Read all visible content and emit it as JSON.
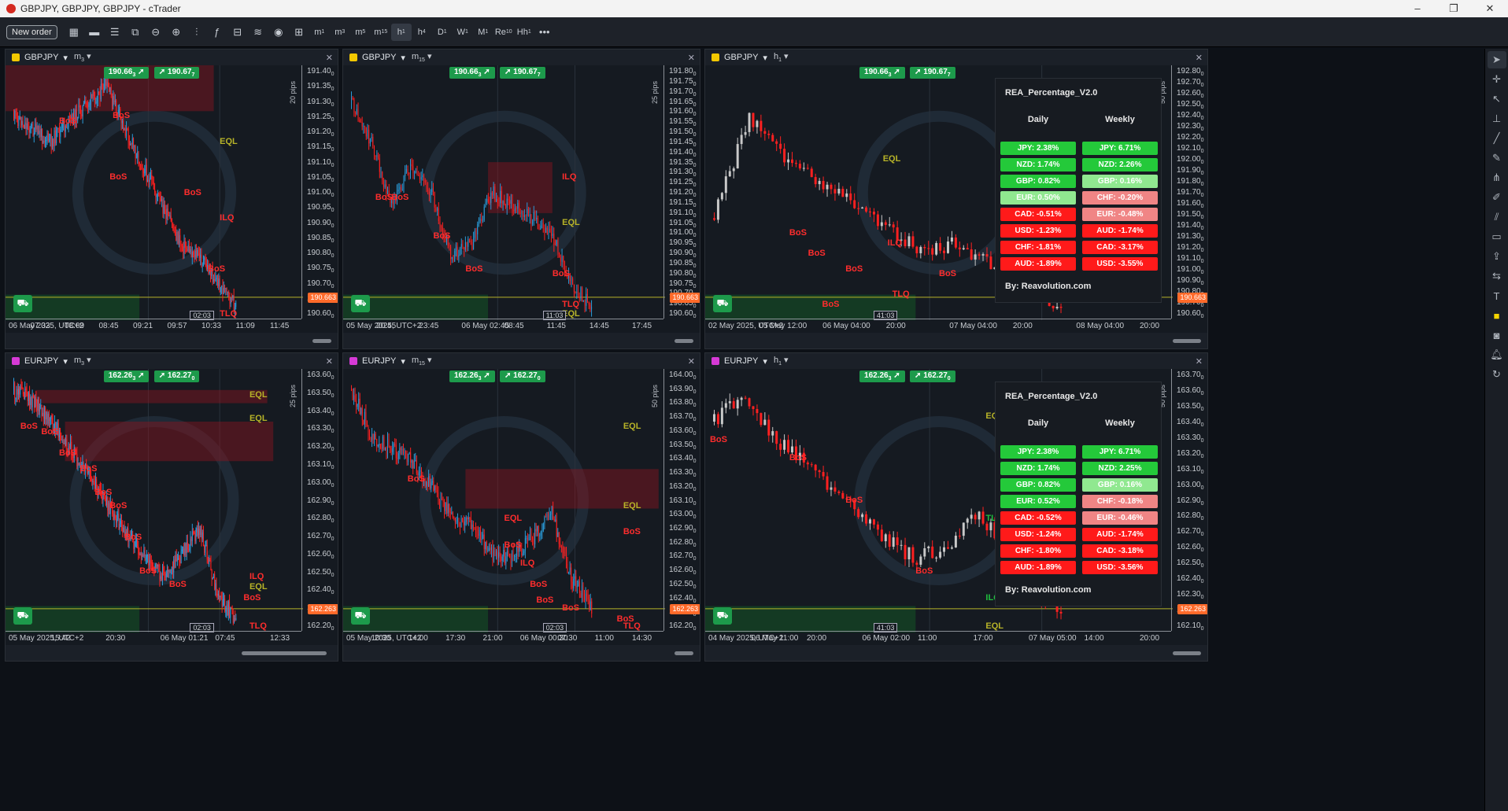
{
  "window": {
    "title": "GBPJPY, GBPJPY, GBPJPY - cTrader",
    "controls": [
      "–",
      "❐",
      "✕"
    ]
  },
  "toolbar": {
    "new_order": "New order",
    "timeframes": [
      {
        "main": "m",
        "sub": "1"
      },
      {
        "main": "m",
        "sub": "3"
      },
      {
        "main": "m",
        "sub": "5"
      },
      {
        "main": "m",
        "sub": "15"
      },
      {
        "main": "h",
        "sub": "1"
      },
      {
        "main": "h",
        "sub": "4"
      },
      {
        "main": "D",
        "sub": "1"
      },
      {
        "main": "W",
        "sub": "1"
      },
      {
        "main": "M",
        "sub": "1"
      },
      {
        "main": "Re",
        "sub": "10"
      },
      {
        "main": "Hh",
        "sub": "1"
      }
    ],
    "more": "•••"
  },
  "colors": {
    "up": "#2b9bd8",
    "down": "#ff2020",
    "up_h1": "#c8c8c8",
    "bos": "#ff2d2d",
    "eql": "#b7b328",
    "quote_bg": "#1d9a4b",
    "price_tag": "#ff6a2a"
  },
  "panels": [
    {
      "symbol": "GBPJPY",
      "icon": "#f2c800",
      "timeframe": {
        "main": "m",
        "sub": "3"
      },
      "bid": {
        "main": "190.66",
        "sub": "3"
      },
      "ask": {
        "main": "190.67",
        "sub": "7"
      },
      "pips": "20 pips",
      "price": "190.663",
      "countdown": "02:03",
      "yticks": [
        "191.40",
        "191.35",
        "191.30",
        "191.25",
        "191.20",
        "191.15",
        "191.10",
        "191.05",
        "191.00",
        "190.95",
        "190.90",
        "190.85",
        "190.80",
        "190.75",
        "190.70",
        "190.65",
        "190.60"
      ],
      "ytick_sub": "0",
      "ytick_extra": "190.677",
      "xticks": [
        "06 May 2025, UTC+2",
        "07:33",
        "08:09",
        "08:45",
        "09:21",
        "09:57",
        "10:33",
        "11:09",
        "11:45"
      ],
      "labels": [
        "BoS",
        "BoS",
        "BoS",
        "EQL",
        "BoS",
        "ILQ",
        "BoS",
        "TLQ"
      ]
    },
    {
      "symbol": "GBPJPY",
      "icon": "#f2c800",
      "timeframe": {
        "main": "m",
        "sub": "15"
      },
      "bid": {
        "main": "190.66",
        "sub": "3"
      },
      "ask": {
        "main": "190.67",
        "sub": "7"
      },
      "pips": "25 pips",
      "price": "190.663",
      "countdown": "11:03",
      "yticks": [
        "191.80",
        "191.75",
        "191.70",
        "191.65",
        "191.60",
        "191.55",
        "191.50",
        "191.45",
        "191.40",
        "191.35",
        "191.30",
        "191.25",
        "191.20",
        "191.15",
        "191.10",
        "191.05",
        "191.00",
        "190.95",
        "190.90",
        "190.85",
        "190.80",
        "190.75",
        "190.70",
        "190.65",
        "190.60"
      ],
      "ytick_sub": "0",
      "xticks": [
        "05 May 2025, UTC+2",
        "20:45",
        "23:45",
        "06 May 02:45",
        "08:45",
        "11:45",
        "14:45",
        "17:45"
      ],
      "labels": [
        "BoS",
        "BoS",
        "ILQ",
        "BoS",
        "EQL",
        "BoS",
        "BoS",
        "TLQ",
        "EQL"
      ]
    },
    {
      "symbol": "GBPJPY",
      "icon": "#f2c800",
      "timeframe": {
        "main": "h",
        "sub": "1"
      },
      "bid": {
        "main": "190.66",
        "sub": "3"
      },
      "ask": {
        "main": "190.67",
        "sub": "7"
      },
      "pips": "50 pips",
      "price": "190.663",
      "countdown": "41:03",
      "yticks": [
        "192.80",
        "192.70",
        "192.60",
        "192.50",
        "192.40",
        "192.30",
        "192.20",
        "192.10",
        "192.00",
        "191.90",
        "191.80",
        "191.70",
        "191.60",
        "191.50",
        "191.40",
        "191.30",
        "191.20",
        "191.10",
        "191.00",
        "190.90",
        "190.80",
        "190.70",
        "190.60"
      ],
      "ytick_sub": "0",
      "xticks": [
        "02 May 2025, UTC+2",
        "05 May 12:00",
        "06 May 04:00",
        "20:00",
        "07 May 04:00",
        "20:00",
        "08 May 04:00",
        "20:00"
      ],
      "labels": [
        "EQL",
        "BoS",
        "BoS",
        "ILQ",
        "BoS",
        "BoS",
        "BoS",
        "TLQ"
      ],
      "rea": {
        "title": "REA_Percentage_V2.0",
        "daily_h": "Daily",
        "weekly_h": "Weekly",
        "by": "By: Reavolution.com",
        "daily": [
          {
            "t": "JPY: 2.38%",
            "c": "#24c93a"
          },
          {
            "t": "NZD: 1.74%",
            "c": "#24c93a"
          },
          {
            "t": "GBP: 0.82%",
            "c": "#24c93a"
          },
          {
            "t": "EUR: 0.50%",
            "c": "#90e890"
          },
          {
            "t": "CAD: -0.51%",
            "c": "#ff1a1a"
          },
          {
            "t": "USD: -1.23%",
            "c": "#ff1a1a"
          },
          {
            "t": "CHF: -1.81%",
            "c": "#ff1a1a"
          },
          {
            "t": "AUD: -1.89%",
            "c": "#ff1a1a"
          }
        ],
        "weekly": [
          {
            "t": "JPY: 6.71%",
            "c": "#24c93a"
          },
          {
            "t": "NZD: 2.26%",
            "c": "#24c93a"
          },
          {
            "t": "GBP: 0.16%",
            "c": "#90e890"
          },
          {
            "t": "CHF: -0.20%",
            "c": "#f08585"
          },
          {
            "t": "EUR: -0.48%",
            "c": "#f08585"
          },
          {
            "t": "AUD: -1.74%",
            "c": "#ff1a1a"
          },
          {
            "t": "CAD: -3.17%",
            "c": "#ff1a1a"
          },
          {
            "t": "USD: -3.55%",
            "c": "#ff1a1a"
          }
        ]
      }
    },
    {
      "symbol": "EURJPY",
      "icon": "#d63ad6",
      "timeframe": {
        "main": "m",
        "sub": "3"
      },
      "bid": {
        "main": "162.26",
        "sub": "3"
      },
      "ask": {
        "main": "162.27",
        "sub": "0"
      },
      "pips": "25 pips",
      "price": "162.263",
      "countdown": "02:03",
      "yticks": [
        "163.60",
        "163.50",
        "163.40",
        "163.30",
        "163.20",
        "163.10",
        "163.00",
        "162.90",
        "162.80",
        "162.70",
        "162.60",
        "162.50",
        "162.40",
        "162.30",
        "162.20"
      ],
      "ytick_sub": "0",
      "xticks": [
        "05 May 2025, UTC+2",
        "15:42",
        "20:30",
        "06 May 01:21",
        "07:45",
        "12:33"
      ],
      "labels": [
        "EQL",
        "EQL",
        "BoS",
        "BoS",
        "BoS",
        "BoS",
        "BoS",
        "BoS",
        "BoS",
        "BoS",
        "BoS",
        "ILQ",
        "EQL",
        "BoS",
        "TLQ"
      ]
    },
    {
      "symbol": "EURJPY",
      "icon": "#d63ad6",
      "timeframe": {
        "main": "m",
        "sub": "15"
      },
      "bid": {
        "main": "162.26",
        "sub": "3"
      },
      "ask": {
        "main": "162.27",
        "sub": "0"
      },
      "pips": "50 pips",
      "price": "162.263",
      "countdown": "02:03",
      "yticks": [
        "164.00",
        "163.90",
        "163.80",
        "163.70",
        "163.60",
        "163.50",
        "163.40",
        "163.30",
        "163.20",
        "163.10",
        "163.00",
        "162.90",
        "162.80",
        "162.70",
        "162.60",
        "162.50",
        "162.40",
        "162.30",
        "162.20"
      ],
      "ytick_sub": "0",
      "xticks": [
        "05 May 2025, UTC+2",
        "10:30",
        "14:00",
        "17:30",
        "21:00",
        "06 May 00:30",
        "07:30",
        "11:00",
        "14:30"
      ],
      "labels": [
        "EQL",
        "EQL",
        "BoS",
        "EQL",
        "BoS",
        "BoS",
        "ILQ",
        "BoS",
        "BoS",
        "BoS",
        "BoS",
        "TLQ"
      ]
    },
    {
      "symbol": "EURJPY",
      "icon": "#d63ad6",
      "timeframe": {
        "main": "h",
        "sub": "1"
      },
      "bid": {
        "main": "162.26",
        "sub": "3"
      },
      "ask": {
        "main": "162.27",
        "sub": "0"
      },
      "pips": "50 pips",
      "price": "162.263",
      "countdown": "41:03",
      "yticks": [
        "163.70",
        "163.60",
        "163.50",
        "163.40",
        "163.30",
        "163.20",
        "163.10",
        "163.00",
        "162.90",
        "162.80",
        "162.70",
        "162.60",
        "162.50",
        "162.40",
        "162.30",
        "162.20",
        "162.10"
      ],
      "ytick_sub": "0",
      "xticks": [
        "04 May 2025, UTC+2",
        "06 May 11:00",
        "20:00",
        "06 May 02:00",
        "11:00",
        "17:00",
        "07 May 05:00",
        "14:00",
        "20:00"
      ],
      "labels": [
        "BoS",
        "EQL",
        "BoS",
        "BoS",
        "TLQ",
        "BoS",
        "ILQ",
        "EQL"
      ],
      "rea": {
        "title": "REA_Percentage_V2.0",
        "daily_h": "Daily",
        "weekly_h": "Weekly",
        "by": "By: Reavolution.com",
        "daily": [
          {
            "t": "JPY: 2.38%",
            "c": "#24c93a"
          },
          {
            "t": "NZD: 1.74%",
            "c": "#24c93a"
          },
          {
            "t": "GBP: 0.82%",
            "c": "#24c93a"
          },
          {
            "t": "EUR: 0.52%",
            "c": "#24c93a"
          },
          {
            "t": "CAD: -0.52%",
            "c": "#ff1a1a"
          },
          {
            "t": "USD: -1.24%",
            "c": "#ff1a1a"
          },
          {
            "t": "CHF: -1.80%",
            "c": "#ff1a1a"
          },
          {
            "t": "AUD: -1.89%",
            "c": "#ff1a1a"
          }
        ],
        "weekly": [
          {
            "t": "JPY: 6.71%",
            "c": "#24c93a"
          },
          {
            "t": "NZD: 2.25%",
            "c": "#24c93a"
          },
          {
            "t": "GBP: 0.16%",
            "c": "#90e890"
          },
          {
            "t": "CHF: -0.18%",
            "c": "#f08585"
          },
          {
            "t": "EUR: -0.46%",
            "c": "#f08585"
          },
          {
            "t": "AUD: -1.74%",
            "c": "#ff1a1a"
          },
          {
            "t": "CAD: -3.18%",
            "c": "#ff1a1a"
          },
          {
            "t": "USD: -3.56%",
            "c": "#ff1a1a"
          }
        ]
      }
    }
  ]
}
